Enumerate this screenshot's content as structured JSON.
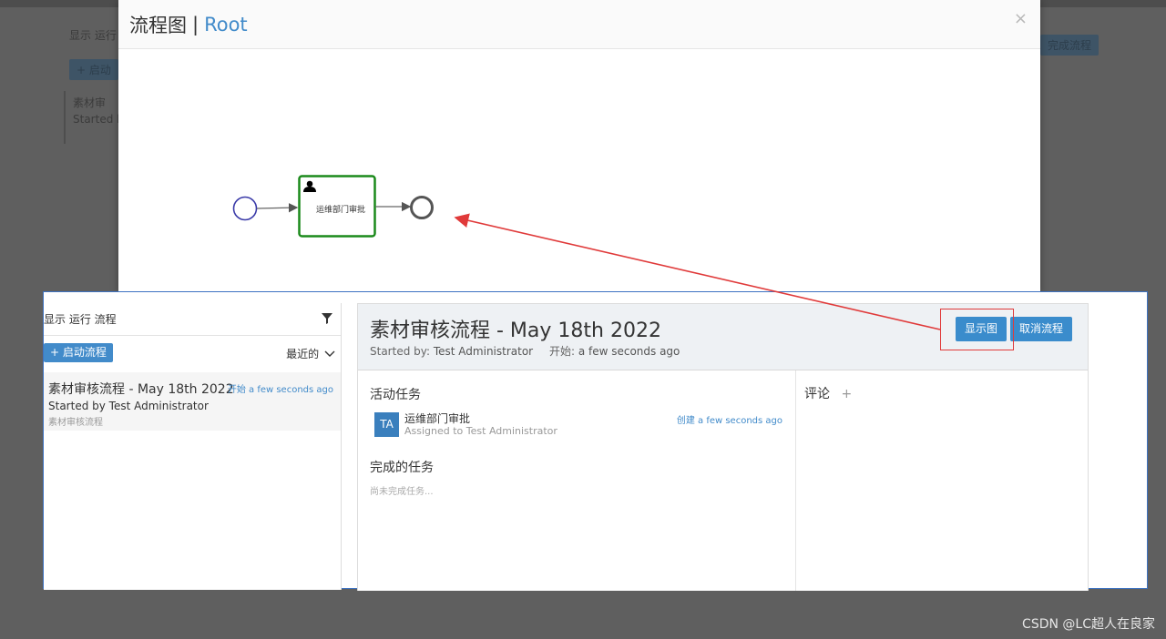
{
  "background": {
    "text_fragments": [
      "显示 运行",
      "+ 启动",
      "素材审",
      "Started b",
      "完成流程"
    ]
  },
  "modal": {
    "title": "流程图",
    "separator": "|",
    "subtitle": "Root",
    "close_glyph": "×",
    "diagram": {
      "task_label": "运维部门审批",
      "task_color": "#1b8a1b",
      "start_color": "#3a3aa8",
      "end_color": "#555555"
    }
  },
  "panel": {
    "left": {
      "header": "显示 运行 流程",
      "start_button": "+ 启动流程",
      "sort_label": "最近的",
      "process": {
        "title": "素材审核流程 - May 18th 2022",
        "when": "开始 a few seconds ago",
        "started_by": "Started by Test Administrator",
        "definition": "素材审核流程"
      }
    },
    "detail": {
      "title": "素材审核流程 - May 18th 2022",
      "started_by_label": "Started by:",
      "started_by_value": "Test Administrator",
      "start_label": "开始:",
      "start_value": "a few seconds ago",
      "show_diagram_button": "显示图",
      "cancel_process_button": "取消流程",
      "active_tasks_title": "活动任务",
      "task": {
        "initials": "TA",
        "name": "运维部门审批",
        "assigned": "Assigned to Test Administrator",
        "created": "创建 a few seconds ago"
      },
      "completed_tasks_title": "完成的任务",
      "no_completed": "尚未完成任务...",
      "comments_title": "评论",
      "comments_add": "+"
    }
  },
  "annotation": {
    "color": "#e03a3a"
  },
  "watermark": "CSDN @LC超人在良家"
}
